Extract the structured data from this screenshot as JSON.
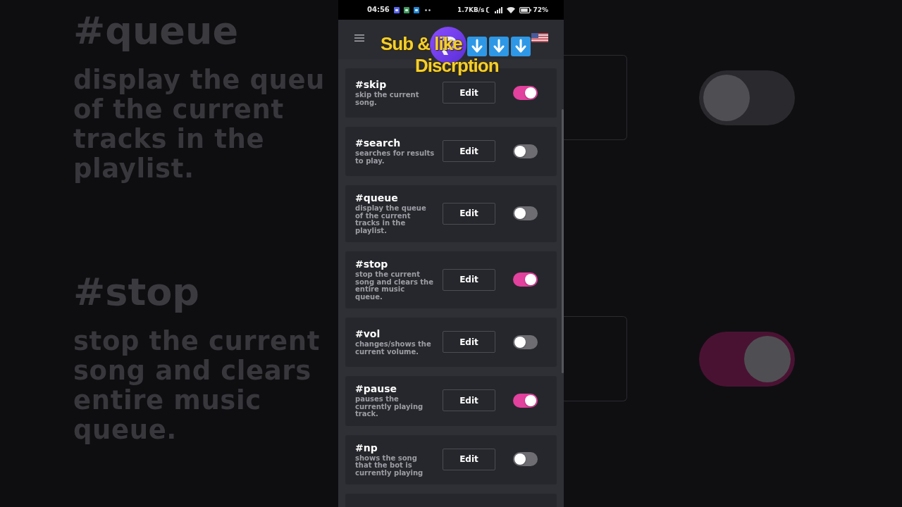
{
  "backdrop": {
    "left": [
      {
        "title": "#queue",
        "description": "display the queu\nof the current\ntracks in the\nplaylist."
      },
      {
        "title": "#stop",
        "description": "stop the current\nsong and clears\nentire music\nqueue."
      }
    ],
    "right": [
      {
        "on": false
      },
      {
        "on": true
      }
    ]
  },
  "status_bar": {
    "time": "04:56",
    "net_speed": "1.7KB/s",
    "battery": "72%"
  },
  "overlay": {
    "line_1": "Sub & like",
    "line_2": "Discrption"
  },
  "commands": [
    {
      "name": "#skip",
      "description": "skip the current\nsong.",
      "button": "Edit",
      "enabled": true
    },
    {
      "name": "#search",
      "description": "searches for results\nto play.",
      "button": "Edit",
      "enabled": false
    },
    {
      "name": "#queue",
      "description": "display the queue\nof the current\ntracks in the\nplaylist.",
      "button": "Edit",
      "enabled": false
    },
    {
      "name": "#stop",
      "description": "stop the current\nsong and clears the\nentire music\nqueue.",
      "button": "Edit",
      "enabled": true
    },
    {
      "name": "#vol",
      "description": "changes/shows the\ncurrent volume.",
      "button": "Edit",
      "enabled": false
    },
    {
      "name": "#pause",
      "description": "pauses the\ncurrently playing\ntrack.",
      "button": "Edit",
      "enabled": true
    },
    {
      "name": "#np",
      "description": "shows the song\nthat the bot is\ncurrently playing",
      "button": "Edit",
      "enabled": false
    }
  ]
}
